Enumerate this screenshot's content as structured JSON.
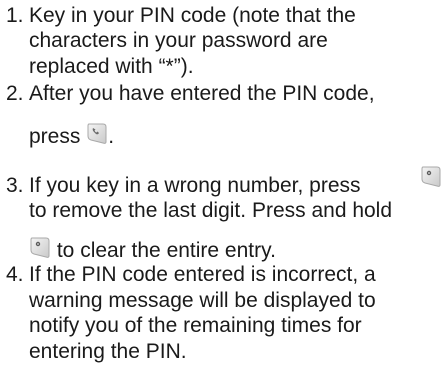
{
  "instructions": [
    {
      "number": "1.",
      "lines": [
        "Key in your PIN code (note that the",
        "characters in your password are",
        "replaced with “*”)."
      ]
    },
    {
      "number": "2.",
      "lines": [
        "After you have entered the PIN code,",
        "press",
        "."
      ]
    },
    {
      "number": "3.",
      "lines": [
        "If you key in a wrong number, press",
        "to remove the last digit. Press and hold",
        "to clear the entire entry."
      ]
    },
    {
      "number": "4.",
      "lines": [
        "If the PIN code entered is incorrect, a",
        "warning message will be displayed to",
        "notify you of the remaining times for",
        "entering the PIN."
      ]
    }
  ],
  "icons": {
    "call_key": "call-key-icon",
    "clear_key": "clear-key-icon"
  }
}
